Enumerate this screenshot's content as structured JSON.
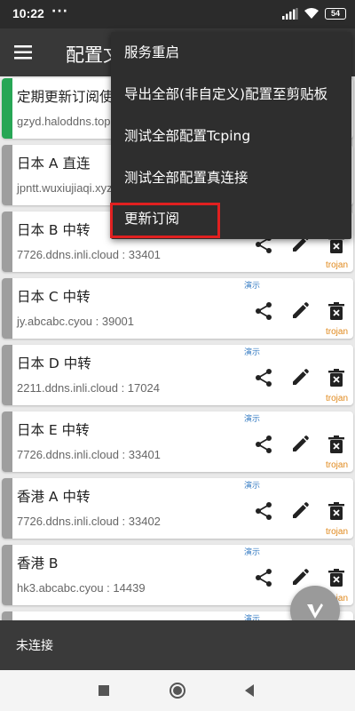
{
  "status": {
    "time": "10:22",
    "dots": "···",
    "battery": "54"
  },
  "header": {
    "title": "配置文件"
  },
  "menu": {
    "items": [
      "服务重启",
      "导出全部(非自定义)配置至剪贴板",
      "测试全部配置Tcping",
      "测试全部配置真连接",
      "更新订阅"
    ],
    "highlighted_index": 4
  },
  "servers": [
    {
      "name": "定期更新订阅使用",
      "address": "gzyd.haloddns.top",
      "tag": "",
      "protocol": "",
      "active": true
    },
    {
      "name": "日本 A 直连",
      "address": "jpntt.wuxiujiaqi.xyz",
      "tag": "",
      "protocol": "",
      "active": false
    },
    {
      "name": "日本 B 中转",
      "address": "7726.ddns.inli.cloud : 33401",
      "tag": "",
      "protocol": "trojan",
      "active": false
    },
    {
      "name": "日本 C 中转",
      "address": "jy.abcabc.cyou : 39001",
      "tag": "演示",
      "protocol": "trojan",
      "active": false
    },
    {
      "name": "日本 D 中转",
      "address": "2211.ddns.inli.cloud : 17024",
      "tag": "演示",
      "protocol": "trojan",
      "active": false
    },
    {
      "name": "日本 E 中转",
      "address": "7726.ddns.inli.cloud : 33401",
      "tag": "演示",
      "protocol": "trojan",
      "active": false
    },
    {
      "name": "香港 A 中转",
      "address": "7726.ddns.inli.cloud : 33402",
      "tag": "演示",
      "protocol": "trojan",
      "active": false
    },
    {
      "name": "香港 B",
      "address": "hk3.abcabc.cyou : 14439",
      "tag": "演示",
      "protocol": "trojan",
      "active": false
    },
    {
      "name": "",
      "address": "",
      "tag": "演示",
      "protocol": "",
      "active": false
    }
  ],
  "footer": {
    "connection_status": "未连接"
  },
  "colors": {
    "active_bar": "#27a655",
    "inactive_bar": "#9e9e9e",
    "highlight_border": "#e02020",
    "tag_blue": "#3b7fc4",
    "protocol_orange": "#e0881a"
  }
}
